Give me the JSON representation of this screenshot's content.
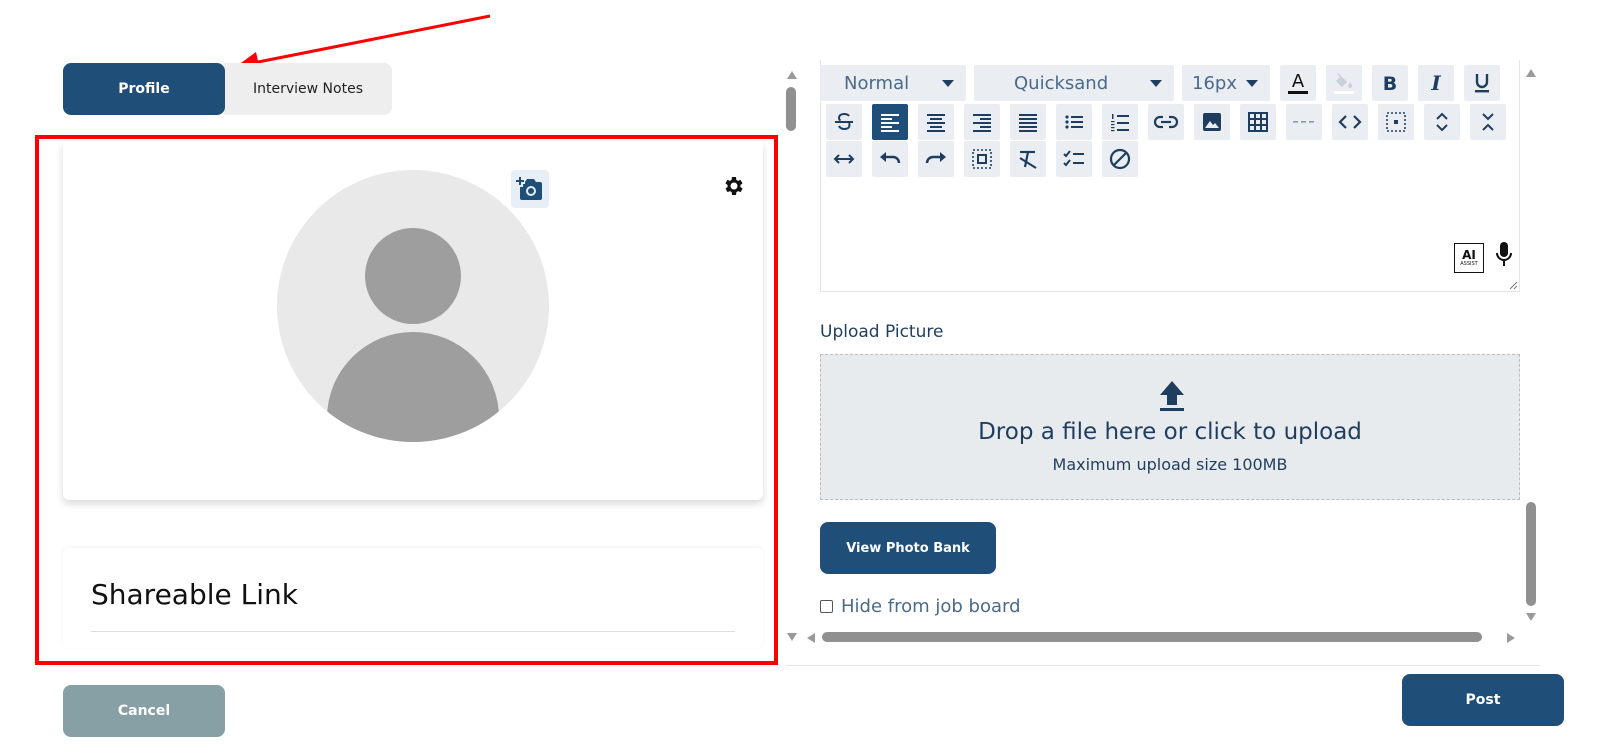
{
  "tabs": {
    "profile": "Profile",
    "interview_notes": "Interview Notes"
  },
  "avatar_card": {
    "camera_icon": "add-photo-icon",
    "settings_icon": "gear-icon"
  },
  "shareable_link": {
    "title": "Shareable Link"
  },
  "editor": {
    "style_select": "Normal",
    "font_select": "Quicksand",
    "size_select": "16px",
    "ai_assist": {
      "main": "AI",
      "sub": "ASSIST"
    }
  },
  "upload": {
    "label": "Upload Picture",
    "drop_text": "Drop a file here or click to upload",
    "max_size": "Maximum upload size 100MB"
  },
  "view_photo_bank": "View Photo Bank",
  "hide_from_job_board": "Hide from job board",
  "cancel": "Cancel",
  "post": "Post",
  "colors": {
    "primary": "#1f4e79",
    "cancel": "#87a0a6",
    "highlight": "#ff0000"
  }
}
